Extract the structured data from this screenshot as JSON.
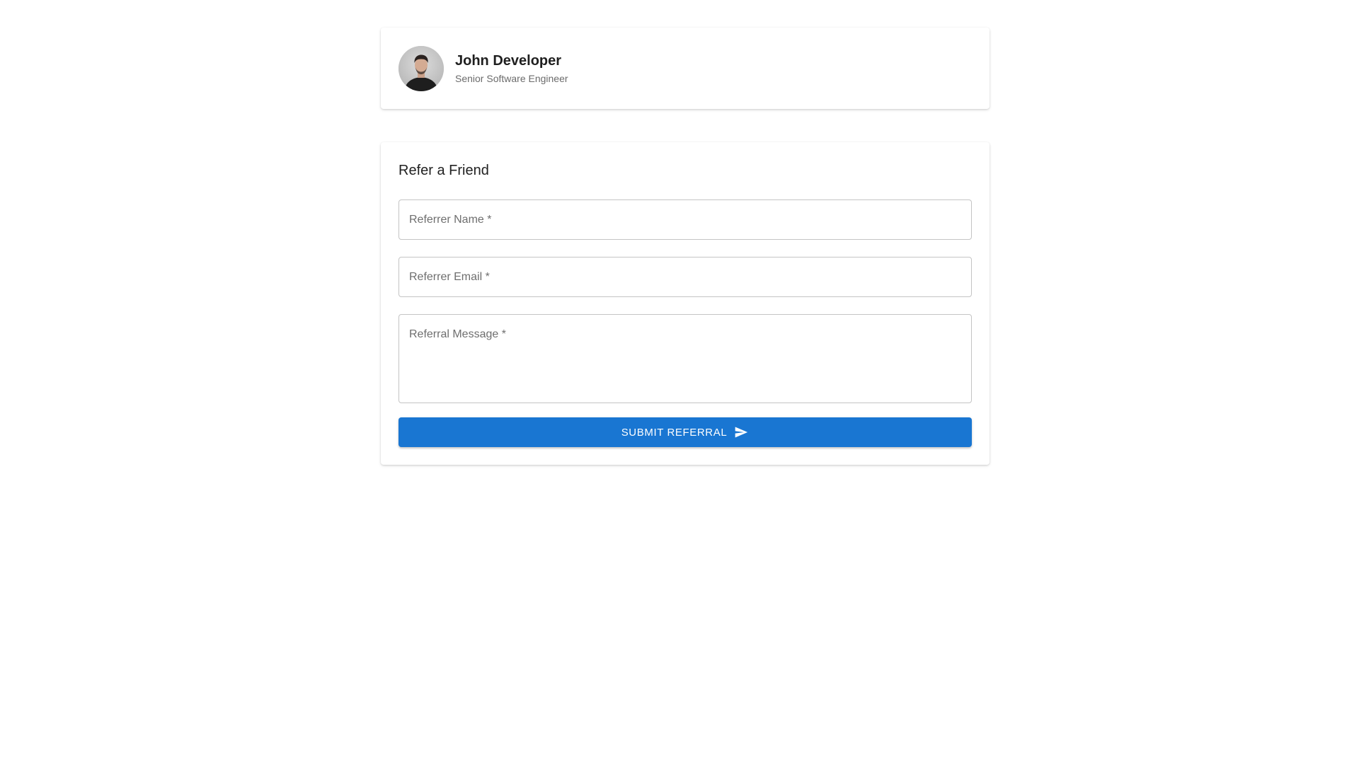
{
  "profile": {
    "name": "John Developer",
    "title": "Senior Software Engineer",
    "avatar_icon": "person-avatar-icon"
  },
  "form": {
    "title": "Refer a Friend",
    "fields": {
      "referrer_name": {
        "label": "Referrer Name *",
        "value": ""
      },
      "referrer_email": {
        "label": "Referrer Email *",
        "value": ""
      },
      "referral_message": {
        "label": "Referral Message *",
        "value": ""
      }
    },
    "submit_label": "Submit Referral",
    "submit_icon": "send-icon"
  },
  "colors": {
    "primary": "#1976d2",
    "background": "#ffffff",
    "field_border": "#c4c4c4",
    "label_text": "#6e6e6e"
  }
}
